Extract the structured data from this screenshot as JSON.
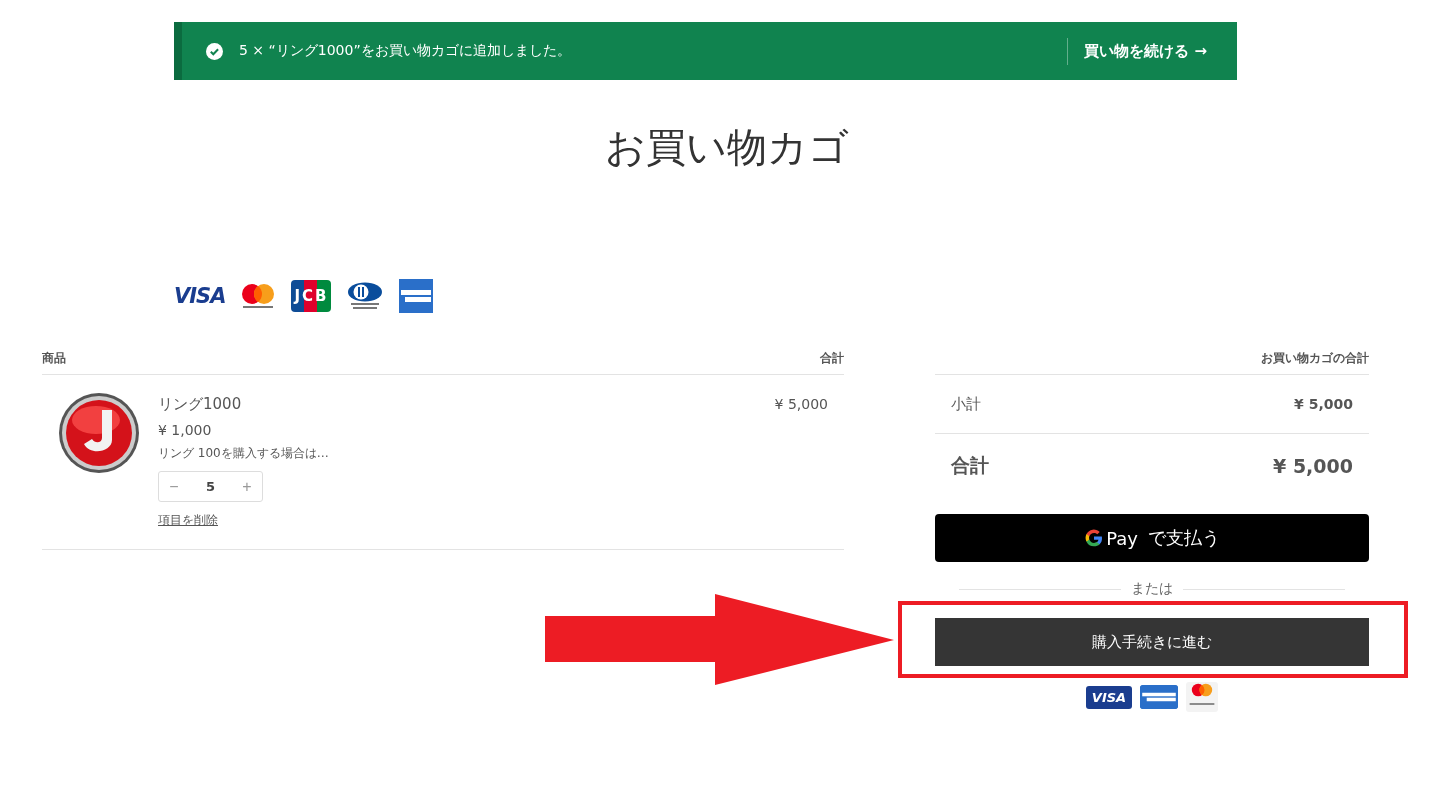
{
  "notice": {
    "message": "5 × “リング1000”をお買い物カゴに追加しました。",
    "action": "買い物を続ける",
    "arrow": "→"
  },
  "title": "お買い物カゴ",
  "card_logos": [
    {
      "kind": "visa",
      "text": "VISA"
    },
    {
      "kind": "mastercard"
    },
    {
      "kind": "jcb",
      "text": "JCB"
    },
    {
      "kind": "diners"
    },
    {
      "kind": "amex"
    }
  ],
  "cart_table": {
    "columns": [
      "商品",
      "合計"
    ],
    "items": [
      {
        "name": "リング1000",
        "price": "¥ 1,000",
        "description": "リング 100を購入する場合は…",
        "decrement": "−",
        "quantity": "5",
        "increment": "+",
        "remove": "項目を削除",
        "total": "¥ 5,000"
      }
    ]
  },
  "totals": {
    "heading": "お買い物カゴの合計",
    "rows": [
      {
        "kind": "subtotal",
        "label": "小計",
        "value": "¥ 5,000"
      },
      {
        "kind": "total",
        "label": "合計",
        "value": "¥ 5,000"
      }
    ]
  },
  "gpay": {
    "brand": "Pay",
    "label": "で支払う"
  },
  "divider": "または",
  "checkout": "購入手続きに進む",
  "accepted_cards": [
    {
      "kind": "visa",
      "text": "VISA"
    },
    {
      "kind": "amex"
    },
    {
      "kind": "mastercard"
    }
  ]
}
